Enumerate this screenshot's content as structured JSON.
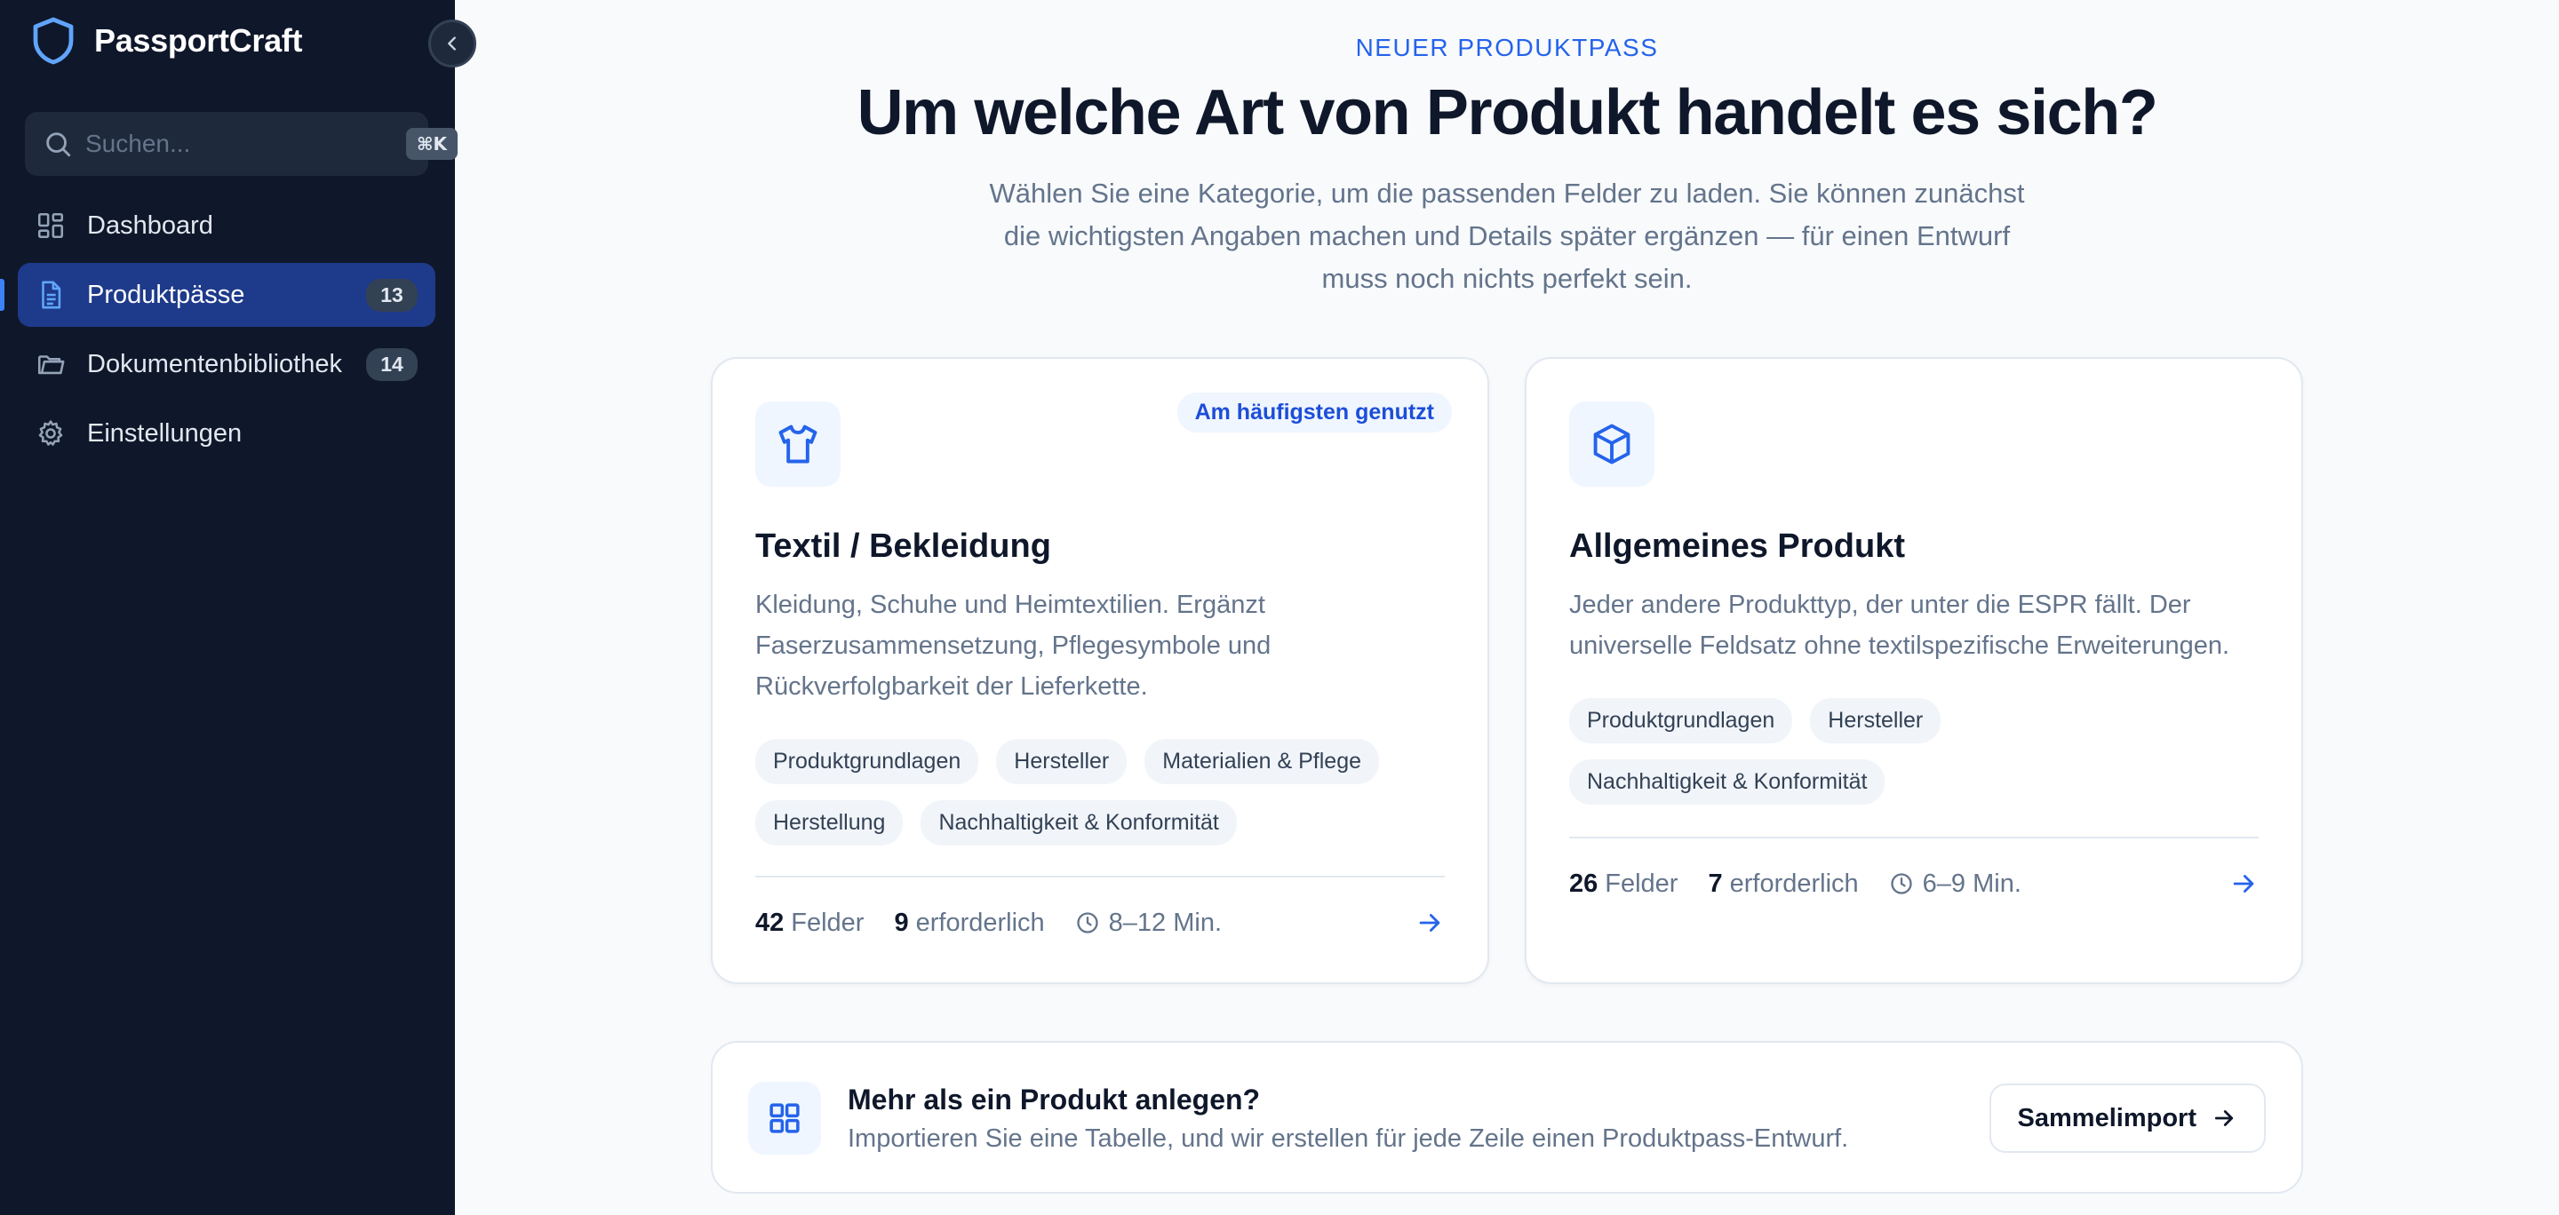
{
  "app": {
    "name": "PassportCraft",
    "logo_icon": "shield-icon",
    "collapse_icon": "chevron-left-icon"
  },
  "search": {
    "placeholder": "Suchen...",
    "shortcut": "⌘K",
    "icon": "search-icon"
  },
  "sidebar": {
    "items": [
      {
        "label": "Dashboard",
        "icon": "grid-icon",
        "badge": null,
        "active": false
      },
      {
        "label": "Produktpässe",
        "icon": "document-icon",
        "badge": "13",
        "active": true
      },
      {
        "label": "Dokumentenbibliothek",
        "icon": "folder-icon",
        "badge": "14",
        "active": false
      },
      {
        "label": "Einstellungen",
        "icon": "gear-icon",
        "badge": null,
        "active": false
      }
    ]
  },
  "main": {
    "eyebrow": "NEUER PRODUKTPASS",
    "title": "Um welche Art von Produkt handelt es sich?",
    "lead": "Wählen Sie eine Kategorie, um die passenden Felder zu laden. Sie können zunächst die wichtigsten Angaben machen und Details später ergänzen — für einen Entwurf muss noch nichts perfekt sein."
  },
  "cards": [
    {
      "icon": "shirt-icon",
      "badge": "Am häufigsten genutzt",
      "title": "Textil / Bekleidung",
      "description": "Kleidung, Schuhe und Heimtextilien. Ergänzt Faserzusammensetzung, Pflegesymbole und Rückverfolgbarkeit der Lieferkette.",
      "tags": [
        "Produktgrundlagen",
        "Hersteller",
        "Materialien & Pflege",
        "Herstellung",
        "Nachhaltigkeit & Konformität"
      ],
      "fields_count": "42",
      "fields_label": "Felder",
      "required_count": "9",
      "required_label": "erforderlich",
      "duration": "8–12 Min."
    },
    {
      "icon": "box-icon",
      "badge": null,
      "title": "Allgemeines Produkt",
      "description": "Jeder andere Produkttyp, der unter die ESPR fällt. Der universelle Feldsatz ohne textilspezifische Erweiterungen.",
      "tags": [
        "Produktgrundlagen",
        "Hersteller",
        "Nachhaltigkeit & Konformität"
      ],
      "fields_count": "26",
      "fields_label": "Felder",
      "required_count": "7",
      "required_label": "erforderlich",
      "duration": "6–9 Min."
    }
  ],
  "bulk": {
    "icon": "grid-icon",
    "title": "Mehr als ein Produkt anlegen?",
    "text": "Importieren Sie eine Tabelle, und wir erstellen für jede Zeile einen Produktpass-Entwurf.",
    "button_label": "Sammelimport"
  },
  "colors": {
    "sidebar_bg": "#0f172a",
    "active_nav_bg": "#1e3a8a",
    "accent": "#2563eb",
    "page_bg": "#f8fafc"
  }
}
